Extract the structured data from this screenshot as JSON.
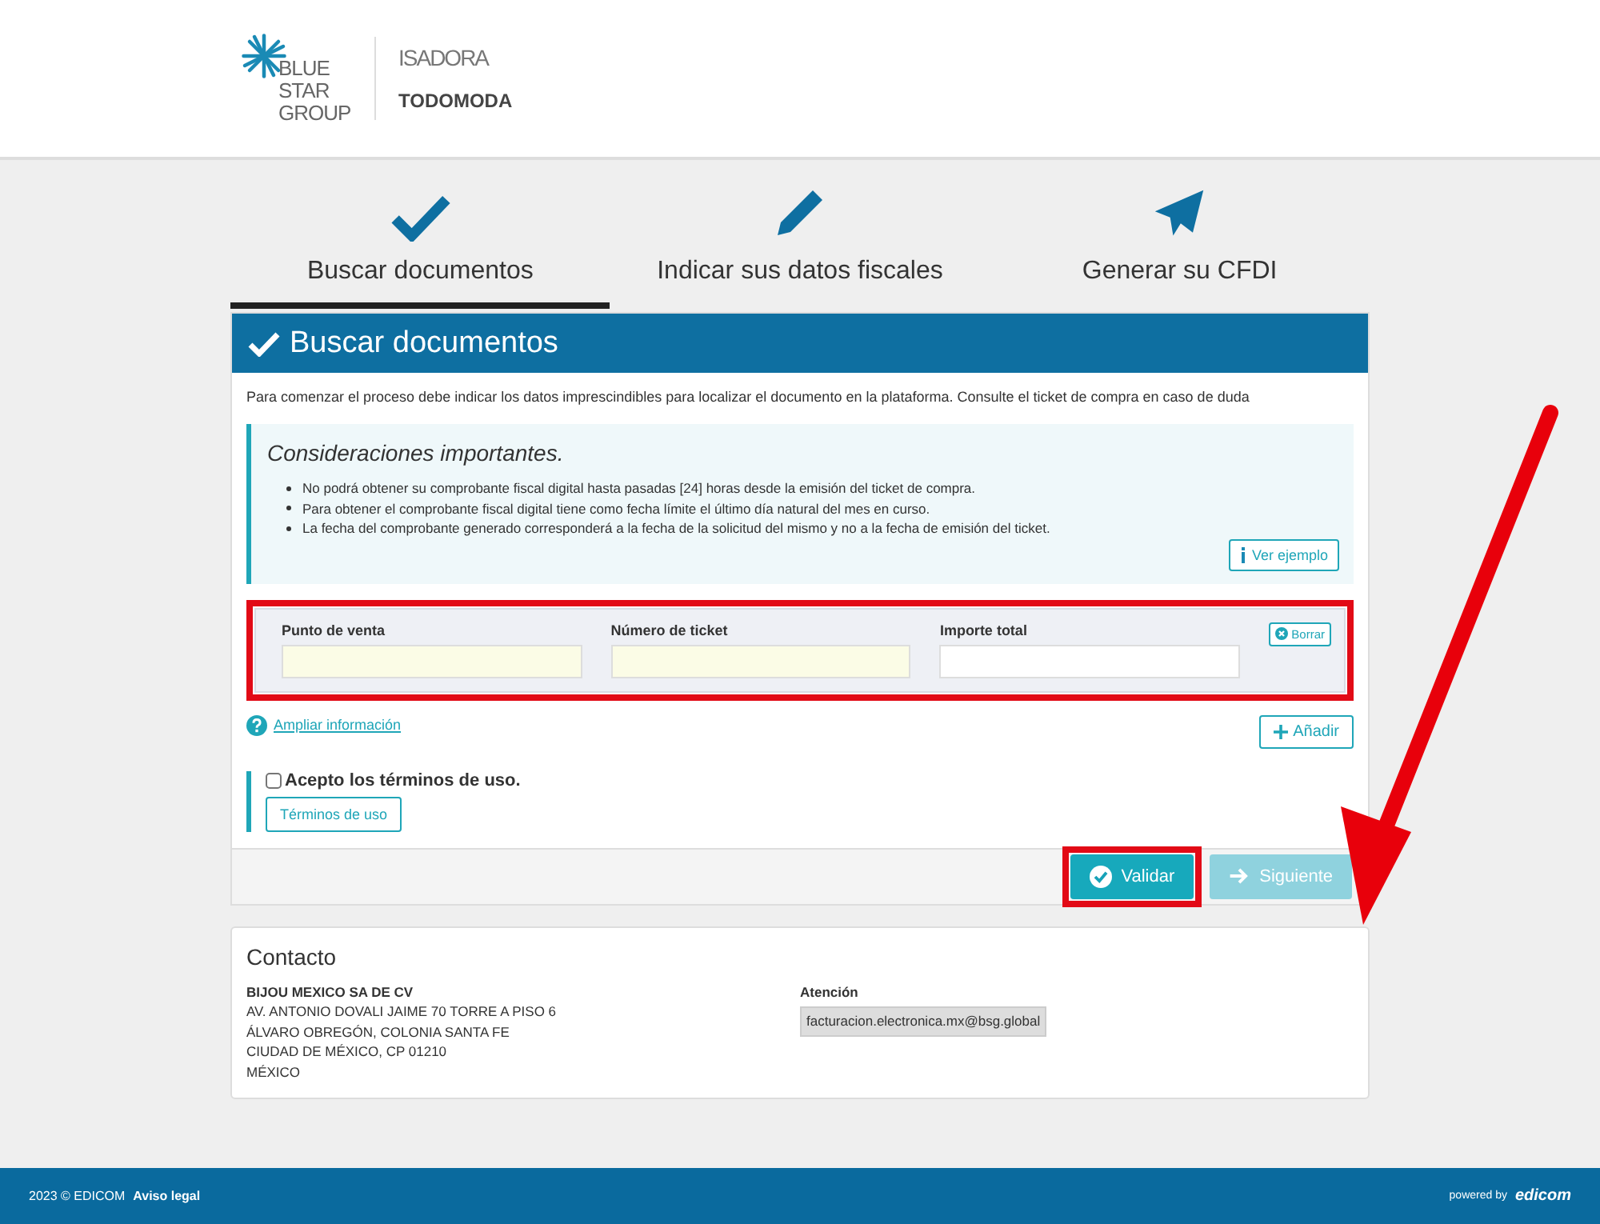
{
  "logos": {
    "group": "BLUE STAR GROUP",
    "brands": [
      "ISADORA",
      "TODOMODA"
    ]
  },
  "steps": [
    {
      "label": "Buscar documentos",
      "selected": true
    },
    {
      "label": "Indicar sus datos fiscales",
      "selected": false
    },
    {
      "label": "Generar su CFDI",
      "selected": false
    }
  ],
  "panel": {
    "title": "Buscar documentos",
    "intro": "Para comenzar el proceso debe indicar los datos imprescindibles para localizar el documento en la plataforma. Consulte el ticket de compra en caso de duda",
    "notice": {
      "title": "Consideraciones importantes.",
      "items": [
        "No podrá obtener su comprobante fiscal digital hasta pasadas [24] horas desde la emisión del ticket de compra.",
        "Para obtener el comprobante fiscal digital tiene como fecha límite el último día natural del mes en curso.",
        "La fecha del comprobante generado corresponderá a la fecha de la solicitud del mismo y no a la fecha de emisión del ticket."
      ],
      "button": "Ver ejemplo"
    },
    "fields": {
      "highlighted": true,
      "items": [
        {
          "label": "Punto de venta",
          "required": true
        },
        {
          "label": "Número de ticket",
          "required": true
        },
        {
          "label": "Importe total",
          "required": false
        }
      ],
      "clear": "Borrar"
    },
    "more_info": "Ampliar información",
    "add": "Añadir",
    "terms": {
      "label": "Acepto los términos de uso.",
      "checked": false,
      "button": "Términos de uso"
    },
    "actions": [
      {
        "label": "Validar",
        "kind": "validate",
        "disabled": false,
        "highlighted": true
      },
      {
        "label": "Siguiente",
        "kind": "next",
        "disabled": true,
        "highlighted": false
      }
    ]
  },
  "contact": {
    "title": "Contacto",
    "company": "BIJOU MEXICO SA DE CV",
    "address": [
      "AV. ANTONIO DOVALI JAIME 70 TORRE A PISO 6",
      "ÁLVARO OBREGÓN, COLONIA SANTA FE",
      "CIUDAD DE MÉXICO, CP 01210",
      "MÉXICO"
    ],
    "attention_label": "Atención",
    "attention_value": "facturacion.electronica.mx@bsg.global"
  },
  "footer": {
    "copyright": "2023 © EDICOM",
    "legal": "Aviso legal",
    "powered": "powered by",
    "brand": "edicom"
  }
}
